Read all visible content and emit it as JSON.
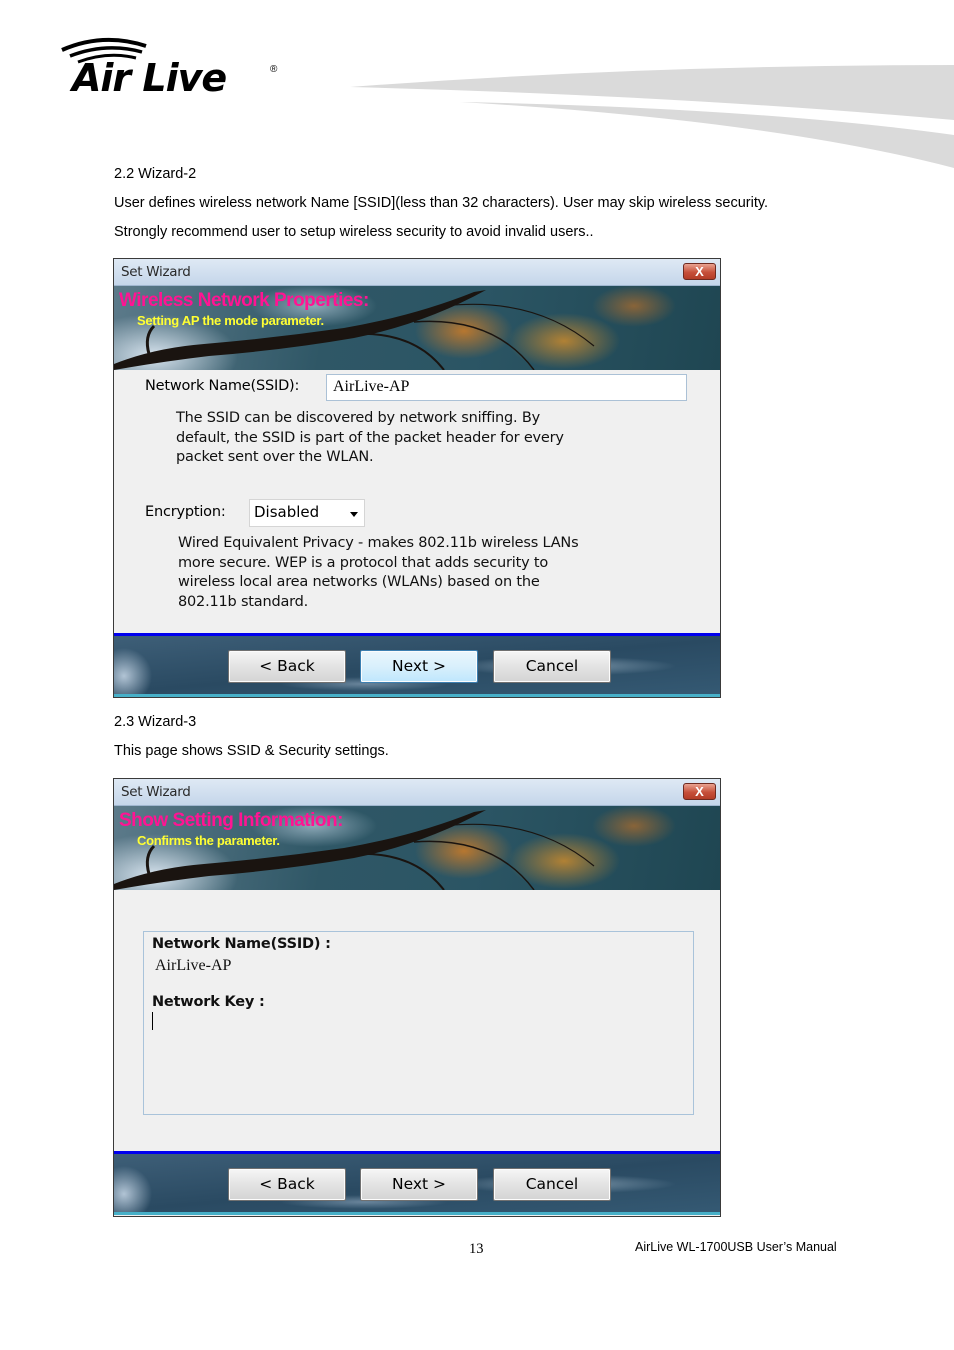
{
  "header": {
    "logo_text": "Air Live",
    "logo_registered": "®"
  },
  "section_2_2": {
    "heading": "2.2 Wizard-2",
    "line1": "User defines wireless network Name [SSID](less than 32 characters). User may skip wireless security.",
    "line2": "Strongly recommend user to setup wireless security to avoid invalid users.."
  },
  "wizard2": {
    "window_title": "Set Wizard",
    "close_label": "X",
    "banner_title": "Wireless Network Properties:",
    "banner_subtitle": "Setting AP the mode parameter.",
    "ssid_label": "Network Name(SSID):",
    "ssid_value": "AirLive-AP",
    "ssid_desc_1": "The SSID can be discovered by network sniffing. By",
    "ssid_desc_2": "default, the SSID is part of the packet header for every",
    "ssid_desc_3": "packet sent over the WLAN.",
    "encryption_label": "Encryption:",
    "encryption_value": "Disabled",
    "enc_desc_1": "Wired Equivalent Privacy - makes 802.11b wireless LANs",
    "enc_desc_2": "more secure. WEP is a protocol that adds security to",
    "enc_desc_3": "wireless local area networks (WLANs) based on the",
    "enc_desc_4": "802.11b standard.",
    "back_label": "< Back",
    "next_label": "Next >",
    "cancel_label": "Cancel"
  },
  "section_2_3": {
    "heading": "2.3 Wizard-3",
    "line1": "This page shows SSID & Security settings."
  },
  "wizard3": {
    "window_title": "Set Wizard",
    "close_label": "X",
    "banner_title": "Show Setting Information:",
    "banner_subtitle": "Confirms the parameter.",
    "ssid_label": "Network Name(SSID) :",
    "ssid_value": "AirLive-AP",
    "key_label": "Network Key :",
    "key_value": "",
    "back_label": "< Back",
    "next_label": "Next >",
    "cancel_label": "Cancel"
  },
  "footer": {
    "page_number": "13",
    "manual_title": "AirLive WL-1700USB User’s Manual"
  }
}
